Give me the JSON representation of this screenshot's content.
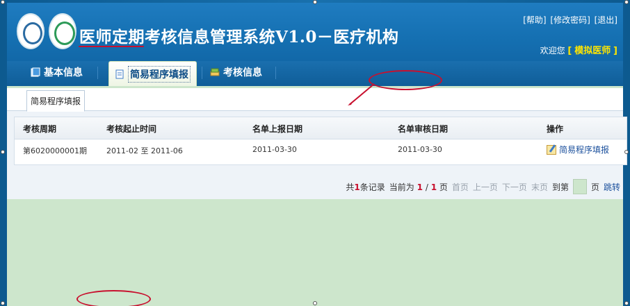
{
  "app": {
    "title": "医师定期考核信息管理系统V1.0－医疗机构"
  },
  "top_links": {
    "help": "[帮助]",
    "change_password": "[修改密码]",
    "logout": "[退出]"
  },
  "user": {
    "welcome": "欢迎您",
    "bracket_open": "[",
    "name": "模拟医师",
    "bracket_close": "]"
  },
  "nav": {
    "items": [
      {
        "label": "基本信息",
        "icon": "book-icon"
      },
      {
        "label": "简易程序填报",
        "icon": "document-icon",
        "active": true
      },
      {
        "label": "考核信息",
        "icon": "books-icon"
      }
    ]
  },
  "sub_tab": {
    "label": "简易程序填报"
  },
  "table": {
    "headers": [
      "考核周期",
      "考核起止时间",
      "名单上报日期",
      "名单审核日期",
      "操作"
    ],
    "rows": [
      {
        "period": "第6020000001期",
        "time_range": "2011-02 至 2011-06",
        "report_date": "2011-03-30",
        "review_date": "2011-03-30",
        "action": "简易程序填报"
      }
    ]
  },
  "pager": {
    "total_prefix": "共",
    "total": "1",
    "total_suffix": "条记录",
    "current_prefix": "当前为",
    "current": "1",
    "slash": "/",
    "pages": "1",
    "page_suffix": "页",
    "first": "首页",
    "prev": "上一页",
    "next": "下一页",
    "last": "末页",
    "goto_prefix": "到第",
    "goto_suffix": "页",
    "jump": "跳转"
  },
  "colors": {
    "header_blue": "#1570b2",
    "content_green": "#cde6cc",
    "accent_red": "#c8102e",
    "username_yellow": "#ffe600",
    "link_blue": "#1a4f9c"
  }
}
